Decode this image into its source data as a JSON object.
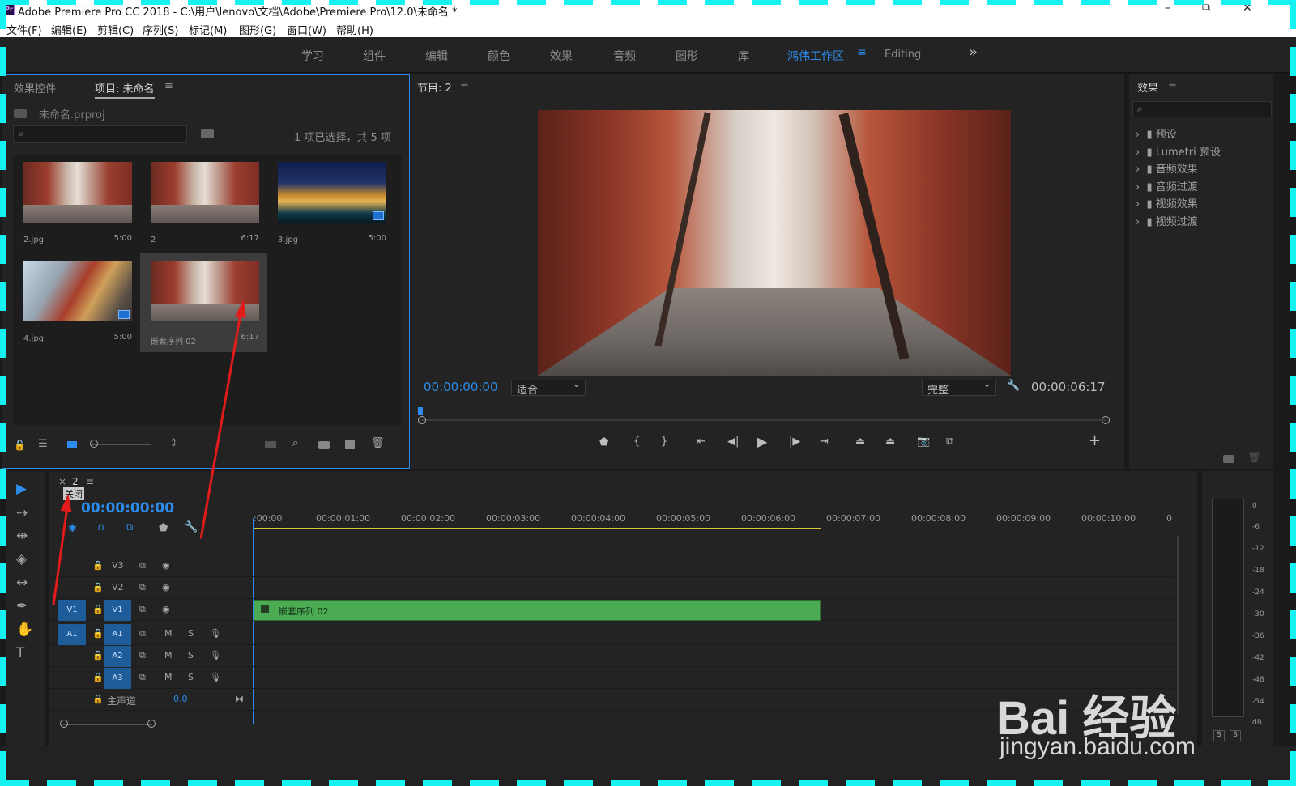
{
  "window": {
    "logo": "Pr",
    "title": "Adobe Premiere Pro CC 2018 - C:\\用户\\lenovo\\文档\\Adobe\\Premiere Pro\\12.0\\未命名 *",
    "minimize": "–",
    "restore": "⧉",
    "close": "✕"
  },
  "menu": [
    "文件(F)",
    "编辑(E)",
    "剪辑(C)",
    "序列(S)",
    "标记(M)",
    "图形(G)",
    "窗口(W)",
    "帮助(H)"
  ],
  "workspaces": {
    "items": [
      "学习",
      "组件",
      "编辑",
      "颜色",
      "效果",
      "音频",
      "图形",
      "库"
    ],
    "active": "鸿伟工作区",
    "menu_icon": "≡",
    "extra": "Editing",
    "overflow": "»"
  },
  "project_panel": {
    "tab_effect_controls": "效果控件",
    "tab_project": "项目: 未命名",
    "tab_menu": "≡",
    "file_name": "未命名.prproj",
    "selection_status": "1 项已选择，共 5 项",
    "items": [
      {
        "name": "2.jpg",
        "duration": "5:00"
      },
      {
        "name": "2",
        "duration": "6:17"
      },
      {
        "name": "3.jpg",
        "duration": "5:00"
      },
      {
        "name": "4.jpg",
        "duration": "5:00"
      },
      {
        "name": "嵌套序列 02",
        "duration": "6:17"
      }
    ]
  },
  "program_monitor": {
    "tab": "节目: 2",
    "tab_menu": "≡",
    "current_time": "00:00:00:00",
    "fit": "适合",
    "quality": "完整",
    "duration": "00:00:06:17",
    "add_button": "+"
  },
  "effects_panel": {
    "tab": "效果",
    "tab_menu": "≡",
    "items": [
      "预设",
      "Lumetri 预设",
      "音频效果",
      "音频过渡",
      "视频效果",
      "视频过渡"
    ]
  },
  "timeline": {
    "close": "×",
    "sequence": "2",
    "menu": "≡",
    "tooltip": "关闭",
    "timecode": "00:00:00:00",
    "ruler": [
      ":00:00",
      "00:00:01:00",
      "00:00:02:00",
      "00:00:03:00",
      "00:00:04:00",
      "00:00:05:00",
      "00:00:06:00",
      "00:00:07:00",
      "00:00:08:00",
      "00:00:09:00",
      "00:00:10:00",
      "0"
    ],
    "video_tracks": [
      "V3",
      "V2",
      "V1"
    ],
    "audio_tracks": [
      "A1",
      "A2",
      "A3"
    ],
    "source_video": "V1",
    "source_audio": "A1",
    "mute": "M",
    "solo": "S",
    "master_label": "主声道",
    "master_value": "0.0",
    "clip_name": "嵌套序列 02"
  },
  "audio_meter": {
    "scale": [
      "0",
      "-6",
      "-12",
      "-18",
      "-24",
      "-30",
      "-36",
      "-42",
      "-48",
      "-54",
      "dB"
    ],
    "solo_left": "S",
    "solo_right": "S"
  },
  "watermark": {
    "brand": "Bai 经验",
    "url": "jingyan.baidu.com"
  },
  "colors": {
    "accent": "#2d8ceb",
    "clip": "#4aab52",
    "annotation_arrow": "#e41b1b",
    "frame_dash": "#15f2f0"
  }
}
